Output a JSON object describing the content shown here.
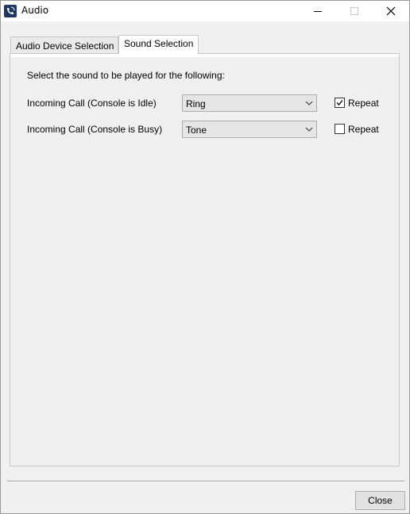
{
  "window": {
    "title": "Audio"
  },
  "tabs": [
    {
      "label": "Audio Device Selection"
    },
    {
      "label": "Sound Selection"
    }
  ],
  "sound_selection": {
    "intro": "Select the sound to be played for the following:",
    "rows": [
      {
        "label": "Incoming Call (Console is Idle)",
        "sound": "Ring",
        "repeat_label": "Repeat",
        "repeat_checked": true
      },
      {
        "label": "Incoming Call (Console is Busy)",
        "sound": "Tone",
        "repeat_label": "Repeat",
        "repeat_checked": false
      }
    ]
  },
  "footer": {
    "close_label": "Close"
  },
  "icons": {
    "app": "phone-ring-icon",
    "minimize": "minimize-icon",
    "maximize": "maximize-icon",
    "close": "close-icon",
    "dropdown": "chevron-down-icon",
    "check": "checkmark-icon"
  }
}
